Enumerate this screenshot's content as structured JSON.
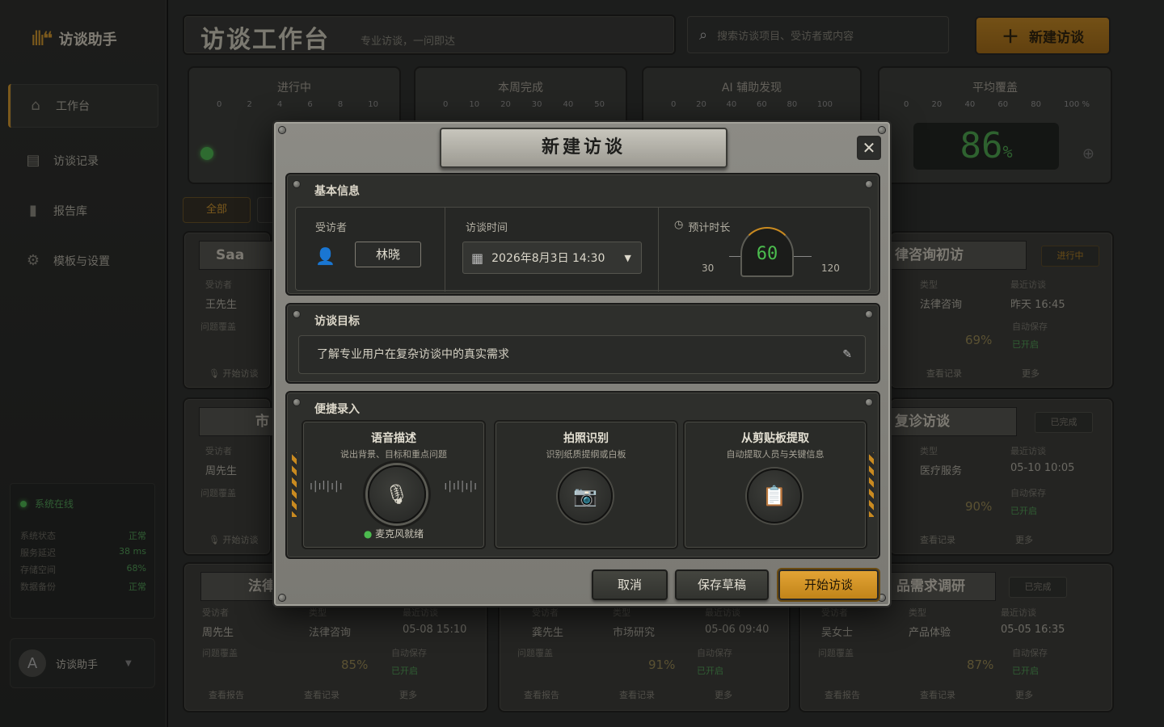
{
  "app": {
    "name": "访谈助手"
  },
  "sidebar": {
    "items": [
      {
        "label": "工作台",
        "icon": "home-icon"
      },
      {
        "label": "访谈记录",
        "icon": "record-icon"
      },
      {
        "label": "报告库",
        "icon": "bar-chart-icon"
      },
      {
        "label": "模板与设置",
        "icon": "gear-icon"
      }
    ],
    "status": {
      "head": "系统在线",
      "rows": [
        {
          "k": "系统状态",
          "v": "正常"
        },
        {
          "k": "服务延迟",
          "v": "38 ms"
        },
        {
          "k": "存储空间",
          "v": "68%"
        },
        {
          "k": "数据备份",
          "v": "正常"
        }
      ]
    },
    "user": {
      "initial": "A",
      "name": "访谈助手"
    }
  },
  "header": {
    "title": "访谈工作台",
    "subtitle": "专业访谈，一问即达",
    "search_placeholder": "搜索访谈项目、受访者或内容",
    "new_label": "新建访谈"
  },
  "metrics": [
    {
      "label": "进行中",
      "ticks": [
        "0",
        "2",
        "4",
        "6",
        "8",
        "10"
      ]
    },
    {
      "label": "本周完成",
      "ticks": [
        "0",
        "10",
        "20",
        "30",
        "40",
        "50"
      ]
    },
    {
      "label": "AI 辅助发现",
      "ticks": [
        "0",
        "20",
        "40",
        "60",
        "80",
        "100"
      ]
    },
    {
      "label": "平均覆盖",
      "ticks": [
        "0",
        "20",
        "40",
        "60",
        "80",
        "100 %"
      ],
      "value": "86",
      "unit": "%"
    }
  ],
  "tabs": [
    {
      "label": "全部"
    }
  ],
  "cards": [
    {
      "title": "Saa",
      "f1k": "受访者",
      "f1v": "王先生",
      "cov": "问题覆盖",
      "foot": "开始访谈"
    },
    {
      "title": "市",
      "f1k": "受访者",
      "f1v": "周先生",
      "cov": "问题覆盖",
      "foot": "开始访谈"
    },
    {
      "title": "法律",
      "f1k": "受访者",
      "f1v": "周先生",
      "f2k": "类型",
      "f2v": "法律咨询",
      "f3k": "最近访谈",
      "f3v": "05-08 15:10",
      "pct": "85%",
      "save": "自动保存",
      "on": "已开启",
      "a": "查看报告",
      "b": "查看记录",
      "c": "更多"
    },
    {
      "f1k": "受访者",
      "f1v": "龚先生",
      "f2k": "类型",
      "f2v": "市场研究",
      "f3k": "最近访谈",
      "f3v": "05-06 09:40",
      "pct": "91%",
      "save": "自动保存",
      "on": "已开启",
      "a": "查看报告",
      "b": "查看记录",
      "c": "更多"
    },
    {
      "title": "品需求调研",
      "tag": "已完成",
      "f1k": "受访者",
      "f1v": "吴女士",
      "f2k": "类型",
      "f2v": "产品体验",
      "f3k": "最近访谈",
      "f3v": "05-05 16:35",
      "pct": "87%",
      "save": "自动保存",
      "on": "已开启",
      "a": "查看报告",
      "b": "查看记录",
      "c": "更多"
    },
    {
      "title": "律咨询初访",
      "tag": "进行中",
      "f2k": "类型",
      "f2v": "法律咨询",
      "f3k": "最近访谈",
      "f3v": "昨天 16:45",
      "pct": "69%",
      "save": "自动保存",
      "on": "已开启",
      "b": "查看记录",
      "c": "更多"
    },
    {
      "title": "复诊访谈",
      "tag": "已完成",
      "f2k": "类型",
      "f2v": "医疗服务",
      "f3k": "最近访谈",
      "f3v": "05-10 10:05",
      "pct": "90%",
      "save": "自动保存",
      "on": "已开启",
      "b": "查看记录",
      "c": "更多"
    }
  ],
  "modal": {
    "title": "新建访谈",
    "basic": {
      "section": "基本信息",
      "interviewee_label": "受访者",
      "interviewee": "林晓",
      "time_label": "访谈时间",
      "time_value": "2026年8月3日 14:30",
      "duration_label": "预计时长",
      "duration_value": "60",
      "duration_min": "30",
      "duration_max": "120"
    },
    "goal": {
      "section": "访谈目标",
      "text": "了解专业用户在复杂访谈中的真实需求"
    },
    "quick": {
      "section": "便捷录入",
      "voice": {
        "title": "语音描述",
        "sub": "说出背景、目标和重点问题",
        "status": "麦克风就绪"
      },
      "photo": {
        "title": "拍照识别",
        "sub": "识别纸质提纲或白板"
      },
      "clip": {
        "title": "从剪贴板提取",
        "sub": "自动提取人员与关键信息"
      }
    },
    "buttons": {
      "cancel": "取消",
      "draft": "保存草稿",
      "start": "开始访谈"
    }
  },
  "colors": {
    "accent": "#d79a2b",
    "online": "#4cbb4f"
  }
}
